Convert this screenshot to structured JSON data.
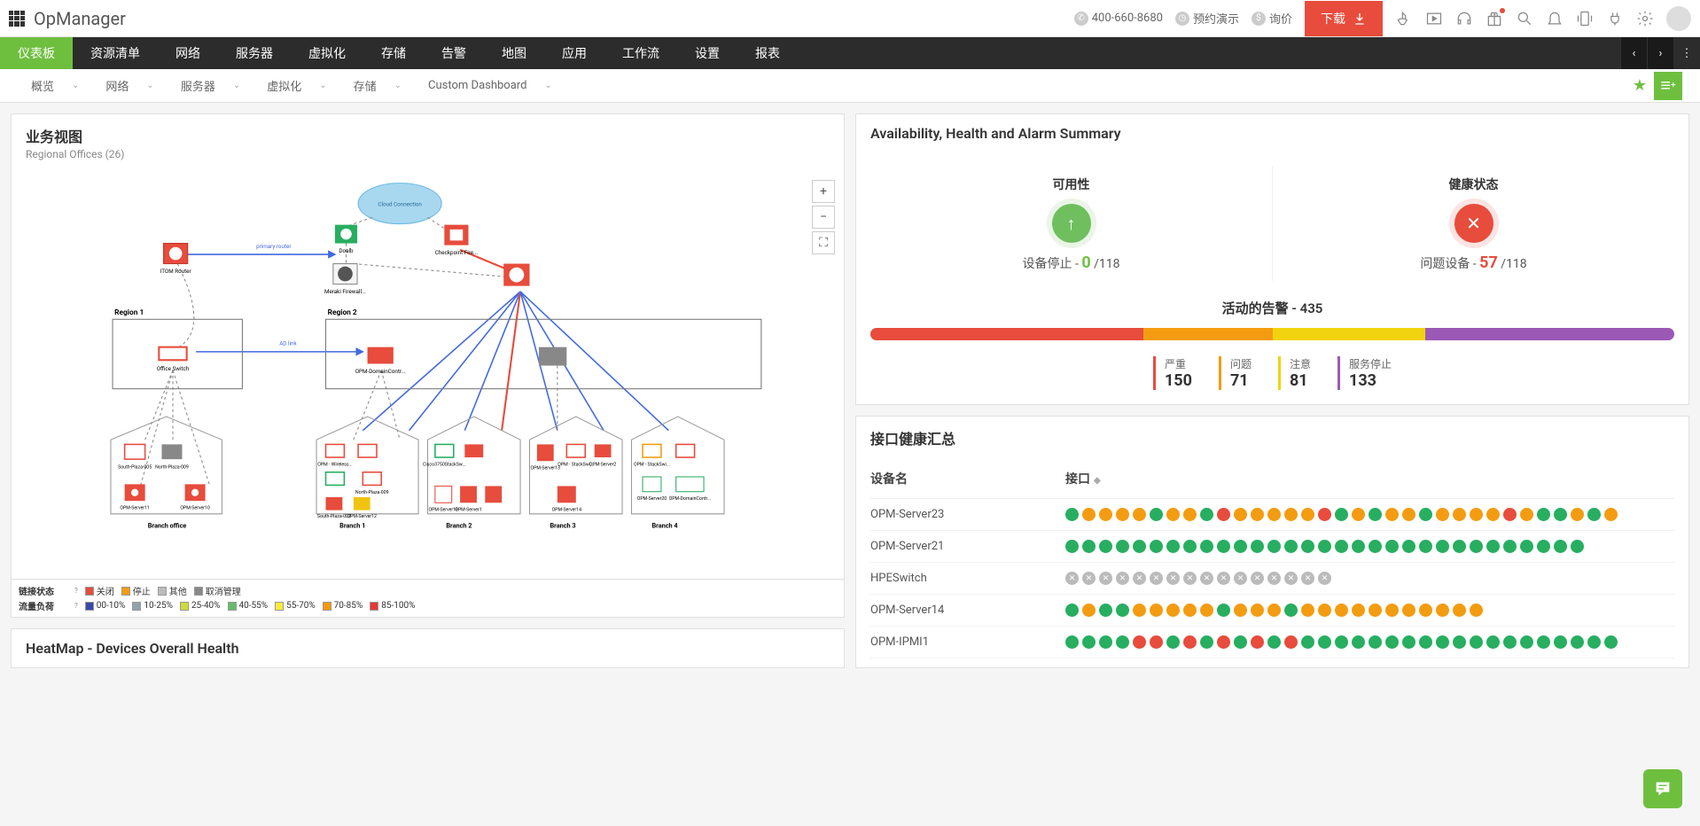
{
  "brand": "OpManager",
  "top": {
    "phone": "400-660-8680",
    "demo": "预约演示",
    "quote": "询价",
    "download": "下载"
  },
  "nav": [
    "仪表板",
    "资源清单",
    "网络",
    "服务器",
    "虚拟化",
    "存储",
    "告警",
    "地图",
    "应用",
    "工作流",
    "设置",
    "报表"
  ],
  "subnav": [
    "概览",
    "网络",
    "服务器",
    "虚拟化",
    "存储",
    "Custom Dashboard"
  ],
  "biz": {
    "title": "业务视图",
    "subtitle": "Regional Offices (26)",
    "legend_link": "链接状态",
    "legend_load": "流量负荷",
    "link_states": [
      "关闭",
      "停止",
      "其他",
      "取消管理"
    ],
    "load_levels": [
      "00-10%",
      "10-25%",
      "25-40%",
      "40-55%",
      "55-70%",
      "70-85%",
      "85-100%"
    ],
    "topo_labels": {
      "itom": "ITOM Router",
      "doalb": "Doalb",
      "cloud": "Cloud Connection",
      "checkpoint": "Checkpoint Fire...",
      "meraki": "Meraki Firewall...",
      "region1": "Region 1",
      "region2": "Region 2",
      "office_switch": "Office Switch",
      "opm_domain": "OPM-DomainContr...",
      "branch_office": "Branch office",
      "branch1": "Branch 1",
      "branch2": "Branch 2",
      "branch3": "Branch 3",
      "branch4": "Branch 4",
      "primary_router": "primary router",
      "ad_link": "AD link",
      "south_plaza_005": "South-Plaza-005",
      "north_plaza_009": "North-Plaza-009",
      "south_plaza_002": "South-Plaza-002",
      "opm_server11": "OPM-Server11",
      "opm_server10": "OPM-Server10",
      "opm_wireless": "OPM - Wireless...",
      "opm_server12": "OPM-Server12",
      "opm_server18": "OPM-Server18",
      "opm_server1": "OPM-Server1",
      "cisco_stack": "Cisco3750StackSw...",
      "opm_server13": "OPM-Server13",
      "opm_server14": "OPM-Server14",
      "opm_server2": "OPM-Server2",
      "opm_stack": "OPM - StackSwi...",
      "opm_server20": "OPM-Server20",
      "opm_domain_c": "OPM-DomainContr..."
    }
  },
  "heatmap": {
    "title": "HeatMap - Devices Overall Health"
  },
  "summary": {
    "title": "Availability, Health and Alarm Summary",
    "avail": "可用性",
    "health": "健康状态",
    "dev_down_lbl": "设备停止 -",
    "dev_down": "0",
    "dev_total": "118",
    "trouble_lbl": "问题设备 -",
    "trouble": "57",
    "trouble_total": "118",
    "active_alarm_lbl": "活动的告警 -",
    "active_alarm": "435",
    "sev": [
      {
        "lbl": "严重",
        "val": "150",
        "cls": "red",
        "pct": 34
      },
      {
        "lbl": "问题",
        "val": "71",
        "cls": "org",
        "pct": 16
      },
      {
        "lbl": "注意",
        "val": "81",
        "cls": "yel",
        "pct": 19
      },
      {
        "lbl": "服务停止",
        "val": "133",
        "cls": "pur",
        "pct": 31
      }
    ]
  },
  "iface": {
    "title": "接口健康汇总",
    "col_device": "设备名",
    "col_iface": "接口",
    "rows": [
      {
        "name": "OPM-Server23",
        "dots": [
          "g",
          "o",
          "o",
          "o",
          "o",
          "g",
          "o",
          "o",
          "g",
          "r",
          "o",
          "o",
          "o",
          "o",
          "o",
          "r",
          "g",
          "o",
          "g",
          "o",
          "o",
          "g",
          "o",
          "o",
          "o",
          "o",
          "r",
          "o",
          "g",
          "g",
          "o",
          "g",
          "o"
        ]
      },
      {
        "name": "OPM-Server21",
        "dots": [
          "g",
          "g",
          "g",
          "g",
          "g",
          "g",
          "g",
          "g",
          "g",
          "g",
          "g",
          "g",
          "g",
          "g",
          "g",
          "g",
          "g",
          "g",
          "g",
          "g",
          "g",
          "g",
          "g",
          "g",
          "g",
          "g",
          "g",
          "g",
          "g",
          "g",
          "g"
        ]
      },
      {
        "name": "HPESwitch",
        "dots": [
          "x",
          "x",
          "x",
          "x",
          "x",
          "x",
          "x",
          "x",
          "x",
          "x",
          "x",
          "x",
          "x",
          "x",
          "x",
          "x"
        ]
      },
      {
        "name": "OPM-Server14",
        "dots": [
          "g",
          "o",
          "g",
          "g",
          "o",
          "o",
          "o",
          "o",
          "o",
          "g",
          "o",
          "o",
          "o",
          "g",
          "o",
          "o",
          "o",
          "o",
          "o",
          "o",
          "o",
          "o",
          "o",
          "o",
          "o"
        ]
      },
      {
        "name": "OPM-IPMI1",
        "dots": [
          "g",
          "g",
          "g",
          "g",
          "r",
          "r",
          "g",
          "r",
          "g",
          "r",
          "g",
          "r",
          "g",
          "r",
          "g",
          "g",
          "g",
          "g",
          "g",
          "g",
          "g",
          "g",
          "g",
          "g",
          "g",
          "g",
          "g",
          "g",
          "g",
          "g",
          "g",
          "g",
          "g"
        ]
      }
    ]
  }
}
